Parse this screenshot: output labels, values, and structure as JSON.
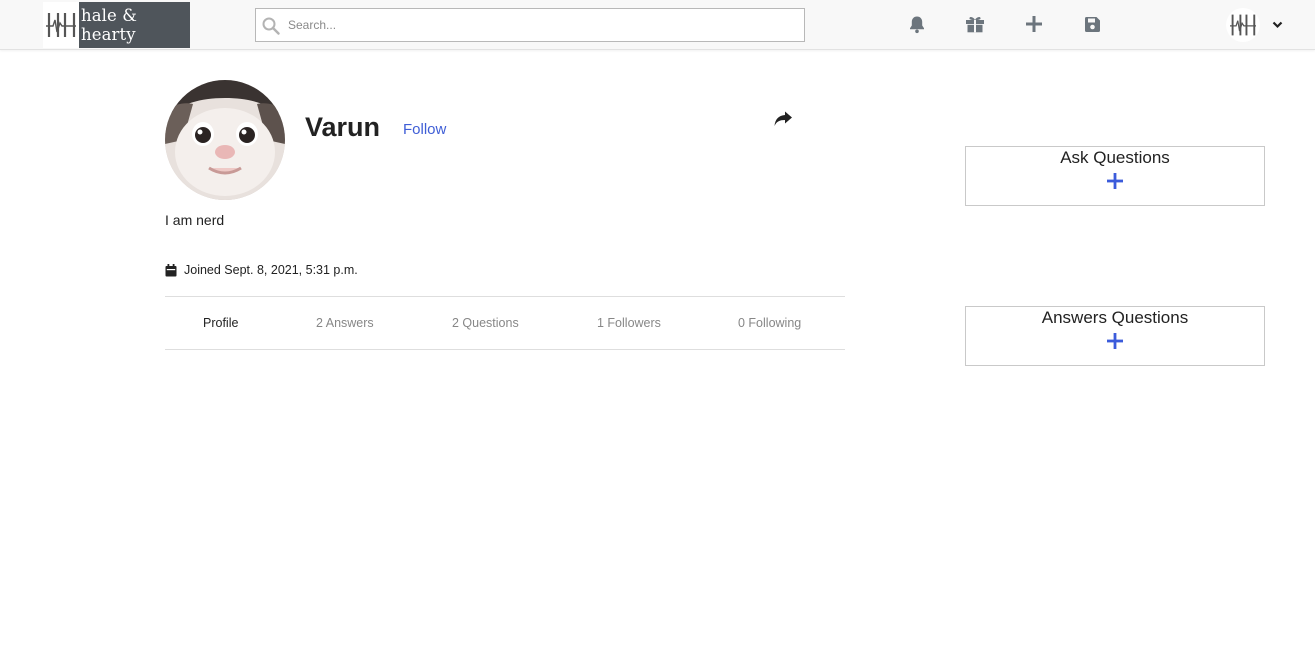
{
  "navbar": {
    "brand_name": "hale & hearty",
    "search_placeholder": "Search...",
    "icons": [
      "bell-icon",
      "gift-icon",
      "plus-icon",
      "save-icon",
      "chevron-down-icon"
    ]
  },
  "profile": {
    "name": "Varun",
    "follow_label": "Follow",
    "bio": "I am nerd",
    "joined": "Joined Sept. 8, 2021, 5:31 p.m."
  },
  "tabs": [
    {
      "label": "Profile",
      "active": true
    },
    {
      "label": "2 Answers"
    },
    {
      "label": "2 Questions"
    },
    {
      "label": "1 Followers"
    },
    {
      "label": "0 Following"
    }
  ],
  "sidebar": {
    "ask": {
      "title": "Ask Questions"
    },
    "answers": {
      "title": "Answers Questions"
    }
  },
  "colors": {
    "accent": "#3f5ed6",
    "plus": "#3b5bdb",
    "brand_bg": "#4f555b",
    "navbar_bg": "#f8f8f8"
  }
}
